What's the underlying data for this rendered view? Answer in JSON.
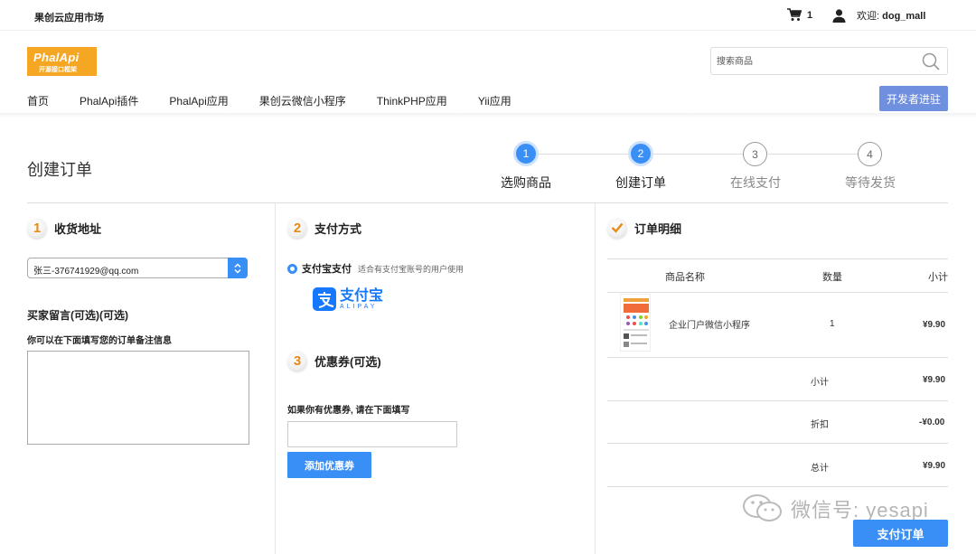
{
  "topbar": {
    "site_name": "果创云应用市场",
    "cart_count": "1",
    "welcome": "欢迎:",
    "username": "dog_mall"
  },
  "header": {
    "logo_text": "PhalApi",
    "logo_sub": "开源接口框架",
    "search_placeholder": "搜索商品",
    "developer_button": "开发者进驻"
  },
  "nav": {
    "items": [
      "首页",
      "PhalApi插件",
      "PhalApi应用",
      "果创云微信小程序",
      "ThinkPHP应用",
      "Yii应用"
    ]
  },
  "page": {
    "title": "创建订单"
  },
  "steps": [
    {
      "num": "1",
      "label": "选购商品",
      "state": "active"
    },
    {
      "num": "2",
      "label": "创建订单",
      "state": "active"
    },
    {
      "num": "3",
      "label": "在线支付",
      "state": "inactive"
    },
    {
      "num": "4",
      "label": "等待发货",
      "state": "inactive"
    }
  ],
  "address": {
    "num": "1",
    "title": "收货地址",
    "selected": "张三-376741929@qq.com"
  },
  "message": {
    "title": "买家留言(可选)(可选)",
    "hint": "你可以在下面填写您的订单备注信息"
  },
  "payment": {
    "num": "2",
    "title": "支付方式",
    "option": "支付宝支付",
    "option_desc": "适合有支付宝账号的用户使用",
    "logo_cn": "支付宝",
    "logo_en": "ALIPAY"
  },
  "coupon": {
    "num": "3",
    "title": "优惠券(可选)",
    "hint": "如果你有优惠券, 请在下面填写",
    "button": "添加优惠券"
  },
  "order": {
    "title": "订单明细",
    "headers": {
      "name": "商品名称",
      "qty": "数量",
      "subtotal": "小计"
    },
    "item": {
      "name": "企业门户微信小程序",
      "qty": "1",
      "price": "¥9.90"
    },
    "summary": [
      {
        "label": "小计",
        "value": "¥9.90"
      },
      {
        "label": "折扣",
        "value": "-¥0.00"
      },
      {
        "label": "总计",
        "value": "¥9.90"
      }
    ]
  },
  "watermark": "微信号: yesapi",
  "submit_button": "支付订单"
}
